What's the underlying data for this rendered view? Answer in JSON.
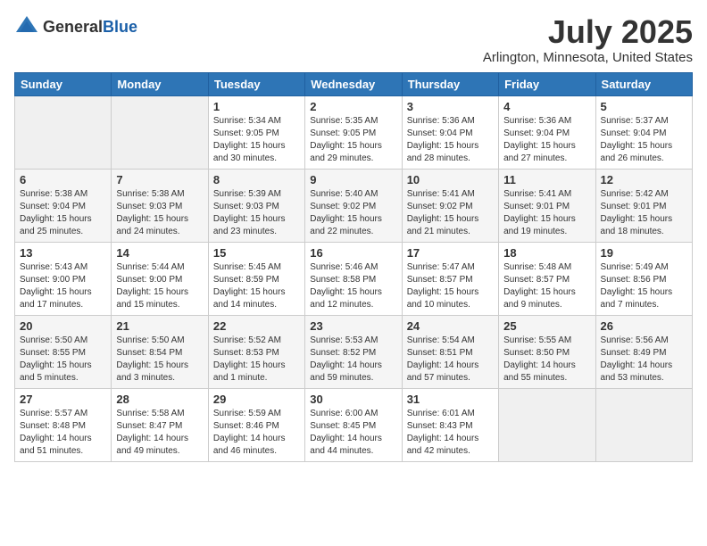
{
  "header": {
    "logo_general": "General",
    "logo_blue": "Blue",
    "month_year": "July 2025",
    "location": "Arlington, Minnesota, United States"
  },
  "days_of_week": [
    "Sunday",
    "Monday",
    "Tuesday",
    "Wednesday",
    "Thursday",
    "Friday",
    "Saturday"
  ],
  "weeks": [
    [
      {
        "day": "",
        "info": ""
      },
      {
        "day": "",
        "info": ""
      },
      {
        "day": "1",
        "info": "Sunrise: 5:34 AM\nSunset: 9:05 PM\nDaylight: 15 hours\nand 30 minutes."
      },
      {
        "day": "2",
        "info": "Sunrise: 5:35 AM\nSunset: 9:05 PM\nDaylight: 15 hours\nand 29 minutes."
      },
      {
        "day": "3",
        "info": "Sunrise: 5:36 AM\nSunset: 9:04 PM\nDaylight: 15 hours\nand 28 minutes."
      },
      {
        "day": "4",
        "info": "Sunrise: 5:36 AM\nSunset: 9:04 PM\nDaylight: 15 hours\nand 27 minutes."
      },
      {
        "day": "5",
        "info": "Sunrise: 5:37 AM\nSunset: 9:04 PM\nDaylight: 15 hours\nand 26 minutes."
      }
    ],
    [
      {
        "day": "6",
        "info": "Sunrise: 5:38 AM\nSunset: 9:04 PM\nDaylight: 15 hours\nand 25 minutes."
      },
      {
        "day": "7",
        "info": "Sunrise: 5:38 AM\nSunset: 9:03 PM\nDaylight: 15 hours\nand 24 minutes."
      },
      {
        "day": "8",
        "info": "Sunrise: 5:39 AM\nSunset: 9:03 PM\nDaylight: 15 hours\nand 23 minutes."
      },
      {
        "day": "9",
        "info": "Sunrise: 5:40 AM\nSunset: 9:02 PM\nDaylight: 15 hours\nand 22 minutes."
      },
      {
        "day": "10",
        "info": "Sunrise: 5:41 AM\nSunset: 9:02 PM\nDaylight: 15 hours\nand 21 minutes."
      },
      {
        "day": "11",
        "info": "Sunrise: 5:41 AM\nSunset: 9:01 PM\nDaylight: 15 hours\nand 19 minutes."
      },
      {
        "day": "12",
        "info": "Sunrise: 5:42 AM\nSunset: 9:01 PM\nDaylight: 15 hours\nand 18 minutes."
      }
    ],
    [
      {
        "day": "13",
        "info": "Sunrise: 5:43 AM\nSunset: 9:00 PM\nDaylight: 15 hours\nand 17 minutes."
      },
      {
        "day": "14",
        "info": "Sunrise: 5:44 AM\nSunset: 9:00 PM\nDaylight: 15 hours\nand 15 minutes."
      },
      {
        "day": "15",
        "info": "Sunrise: 5:45 AM\nSunset: 8:59 PM\nDaylight: 15 hours\nand 14 minutes."
      },
      {
        "day": "16",
        "info": "Sunrise: 5:46 AM\nSunset: 8:58 PM\nDaylight: 15 hours\nand 12 minutes."
      },
      {
        "day": "17",
        "info": "Sunrise: 5:47 AM\nSunset: 8:57 PM\nDaylight: 15 hours\nand 10 minutes."
      },
      {
        "day": "18",
        "info": "Sunrise: 5:48 AM\nSunset: 8:57 PM\nDaylight: 15 hours\nand 9 minutes."
      },
      {
        "day": "19",
        "info": "Sunrise: 5:49 AM\nSunset: 8:56 PM\nDaylight: 15 hours\nand 7 minutes."
      }
    ],
    [
      {
        "day": "20",
        "info": "Sunrise: 5:50 AM\nSunset: 8:55 PM\nDaylight: 15 hours\nand 5 minutes."
      },
      {
        "day": "21",
        "info": "Sunrise: 5:50 AM\nSunset: 8:54 PM\nDaylight: 15 hours\nand 3 minutes."
      },
      {
        "day": "22",
        "info": "Sunrise: 5:52 AM\nSunset: 8:53 PM\nDaylight: 15 hours\nand 1 minute."
      },
      {
        "day": "23",
        "info": "Sunrise: 5:53 AM\nSunset: 8:52 PM\nDaylight: 14 hours\nand 59 minutes."
      },
      {
        "day": "24",
        "info": "Sunrise: 5:54 AM\nSunset: 8:51 PM\nDaylight: 14 hours\nand 57 minutes."
      },
      {
        "day": "25",
        "info": "Sunrise: 5:55 AM\nSunset: 8:50 PM\nDaylight: 14 hours\nand 55 minutes."
      },
      {
        "day": "26",
        "info": "Sunrise: 5:56 AM\nSunset: 8:49 PM\nDaylight: 14 hours\nand 53 minutes."
      }
    ],
    [
      {
        "day": "27",
        "info": "Sunrise: 5:57 AM\nSunset: 8:48 PM\nDaylight: 14 hours\nand 51 minutes."
      },
      {
        "day": "28",
        "info": "Sunrise: 5:58 AM\nSunset: 8:47 PM\nDaylight: 14 hours\nand 49 minutes."
      },
      {
        "day": "29",
        "info": "Sunrise: 5:59 AM\nSunset: 8:46 PM\nDaylight: 14 hours\nand 46 minutes."
      },
      {
        "day": "30",
        "info": "Sunrise: 6:00 AM\nSunset: 8:45 PM\nDaylight: 14 hours\nand 44 minutes."
      },
      {
        "day": "31",
        "info": "Sunrise: 6:01 AM\nSunset: 8:43 PM\nDaylight: 14 hours\nand 42 minutes."
      },
      {
        "day": "",
        "info": ""
      },
      {
        "day": "",
        "info": ""
      }
    ]
  ]
}
